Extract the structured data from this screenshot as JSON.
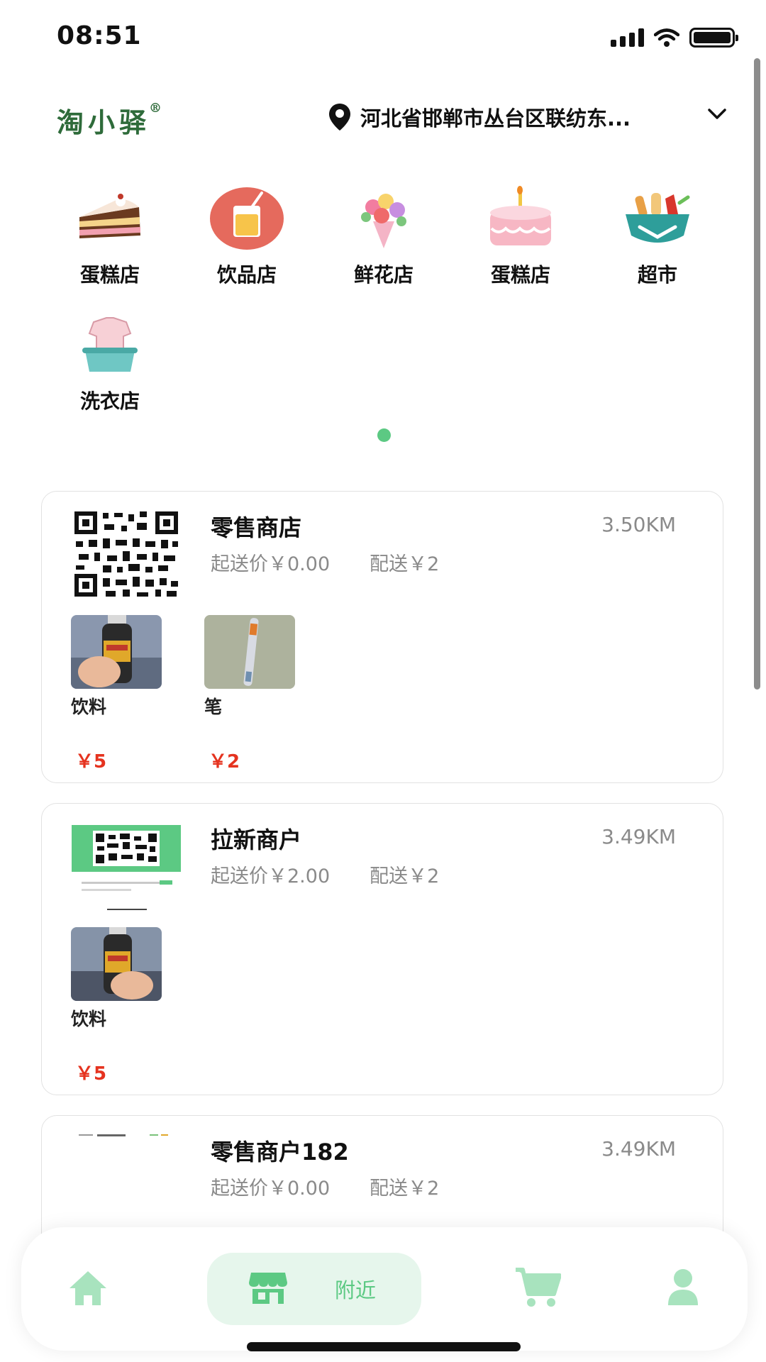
{
  "status_bar": {
    "time": "08:51"
  },
  "header": {
    "logo": "淘小驿",
    "logo_mark": "®",
    "location": "河北省邯郸市丛台区联纺东..."
  },
  "categories": [
    {
      "label": "蛋糕店",
      "icon": "cake-slice-icon"
    },
    {
      "label": "饮品店",
      "icon": "drink-icon"
    },
    {
      "label": "鲜花店",
      "icon": "flower-bouquet-icon"
    },
    {
      "label": "蛋糕店",
      "icon": "birthday-cake-icon"
    },
    {
      "label": "超市",
      "icon": "grocery-basket-icon"
    },
    {
      "label": "洗衣店",
      "icon": "laundry-icon"
    }
  ],
  "stores": [
    {
      "name": "零售商店",
      "distance": "3.50KM",
      "min_order": "起送价￥0.00",
      "delivery": "配送￥2",
      "products": [
        {
          "name": "饮料",
          "price": "￥5"
        },
        {
          "name": "笔",
          "price": "￥2"
        }
      ]
    },
    {
      "name": "拉新商户",
      "distance": "3.49KM",
      "min_order": "起送价￥2.00",
      "delivery": "配送￥2",
      "products": [
        {
          "name": "饮料",
          "price": "￥5"
        }
      ]
    },
    {
      "name": "零售商户182",
      "distance": "3.49KM",
      "min_order": "起送价￥0.00",
      "delivery": "配送￥2",
      "products": []
    }
  ],
  "bottom_nav": {
    "items": [
      {
        "icon": "home-icon"
      },
      {
        "icon": "store-icon",
        "label": "附近",
        "active": true
      },
      {
        "icon": "cart-icon"
      },
      {
        "icon": "user-icon"
      }
    ]
  },
  "colors": {
    "accent": "#5cc983",
    "price": "#e5331f",
    "logo": "#2e6b3a",
    "muted_text": "#8a8a8a",
    "nav_active_bg": "#e6f6ec"
  }
}
